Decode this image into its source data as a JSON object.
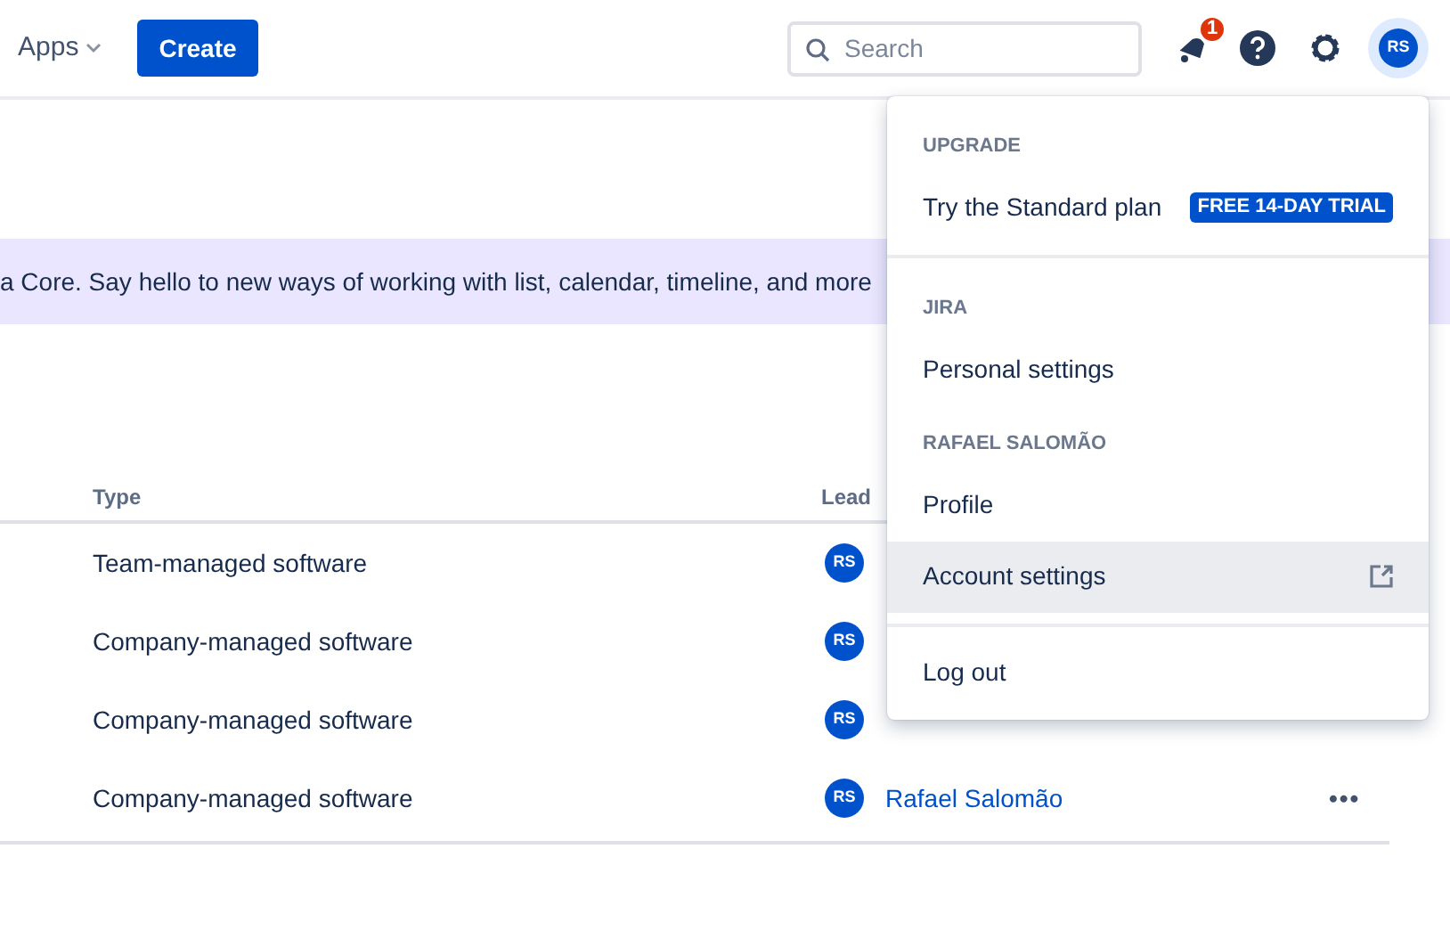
{
  "top_nav": {
    "apps_label": "Apps",
    "create_button": "Create",
    "search": {
      "placeholder": "Search"
    },
    "notification_count": "1",
    "avatar_initials": "RS"
  },
  "banner": {
    "text": "a Core. Say hello to new ways of working with list, calendar, timeline, and more"
  },
  "table": {
    "columns": [
      "Type",
      "Lead"
    ],
    "rows": [
      {
        "type": "Team-managed software",
        "lead_initials": "RS"
      },
      {
        "type": "Company-managed software",
        "lead_initials": "RS"
      },
      {
        "type": "Company-managed software",
        "lead_initials": "RS"
      },
      {
        "type": "Company-managed software",
        "lead_initials": "RS",
        "lead_name": "Rafael Salomão",
        "more_actions": "•••"
      }
    ]
  },
  "profile_menu": {
    "sections": [
      {
        "heading": "UPGRADE",
        "items": [
          {
            "label": "Try the Standard plan",
            "badge": "FREE 14-DAY TRIAL",
            "selected": false
          }
        ]
      },
      {
        "heading": "JIRA",
        "items": [
          {
            "label": "Personal settings",
            "selected": false
          }
        ]
      },
      {
        "heading": "RAFAEL SALOMÃO",
        "items": [
          {
            "label": "Profile",
            "selected": false
          },
          {
            "label": "Account settings",
            "external": true,
            "selected": true
          }
        ]
      },
      {
        "items": [
          {
            "label": "Log out",
            "selected": false
          }
        ]
      }
    ]
  }
}
